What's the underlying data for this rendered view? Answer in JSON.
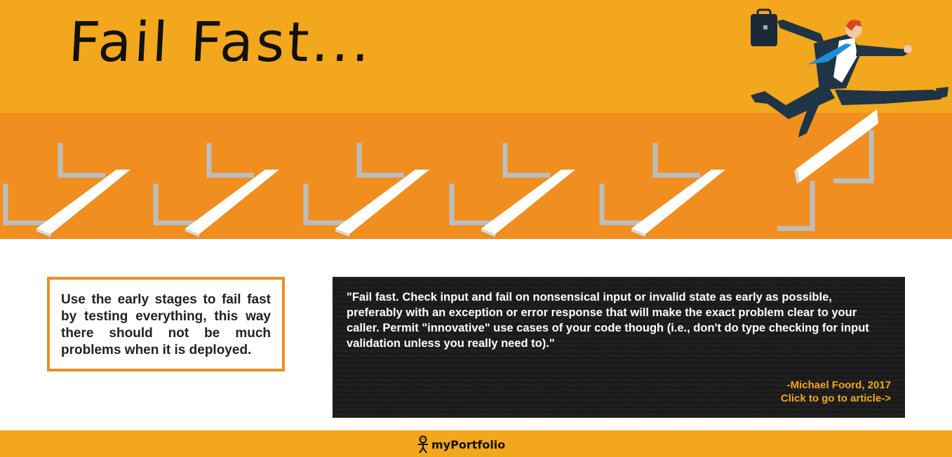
{
  "hero": {
    "title": "Fail Fast...",
    "colors": {
      "banner_top": "#f3a71d",
      "banner_bottom": "#f08e20"
    },
    "illustration": [
      "hurdle-icon",
      "businessman-jumping-icon",
      "briefcase-icon"
    ]
  },
  "callout": {
    "text": "Use the early stages to fail fast by testing everything, this way there should not be much problems when it is deployed.",
    "border_color": "#f08e20"
  },
  "quote": {
    "text": "\"Fail fast. Check input and fail on nonsensical input or invalid state as early as possible, preferably with an exception or error response that will make the exact problem clear to your caller. Permit \"innovative\" use cases of your code though (i.e., don't do type checking for input validation unless you really need to).\"",
    "author": "-Michael Foord, 2017",
    "link_label": "Click to go to article->",
    "accent_color": "#f3a71d"
  },
  "footer": {
    "logo_text": "myPortfolio",
    "logo_icon": "stick-figure-icon"
  }
}
